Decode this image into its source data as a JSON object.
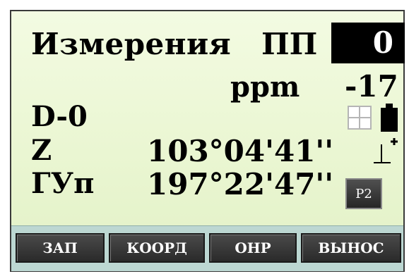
{
  "header": {
    "title": "Измерения",
    "pp_label": "ПП",
    "pp_value": "0"
  },
  "ppm": {
    "label": "ppm",
    "value": "-17"
  },
  "readings": {
    "d_label": "D-0",
    "z_label": "Z",
    "z_value": "103°04'41''",
    "h_label": "ГУп",
    "h_value": "197°22'47''"
  },
  "status_icons": {
    "grid": "grid-icon",
    "battery": "battery-icon",
    "tilt": "tilt-compensator-icon"
  },
  "page_button": "P2",
  "softkeys": [
    "ЗАП",
    "КООРД",
    "ОНР",
    "ВЫНОС"
  ],
  "colors": {
    "screen_bg": "#eaf6d2",
    "softkey_bar": "#bcd7d2",
    "key_bg": "#333333",
    "highlight_box": "#000000"
  }
}
